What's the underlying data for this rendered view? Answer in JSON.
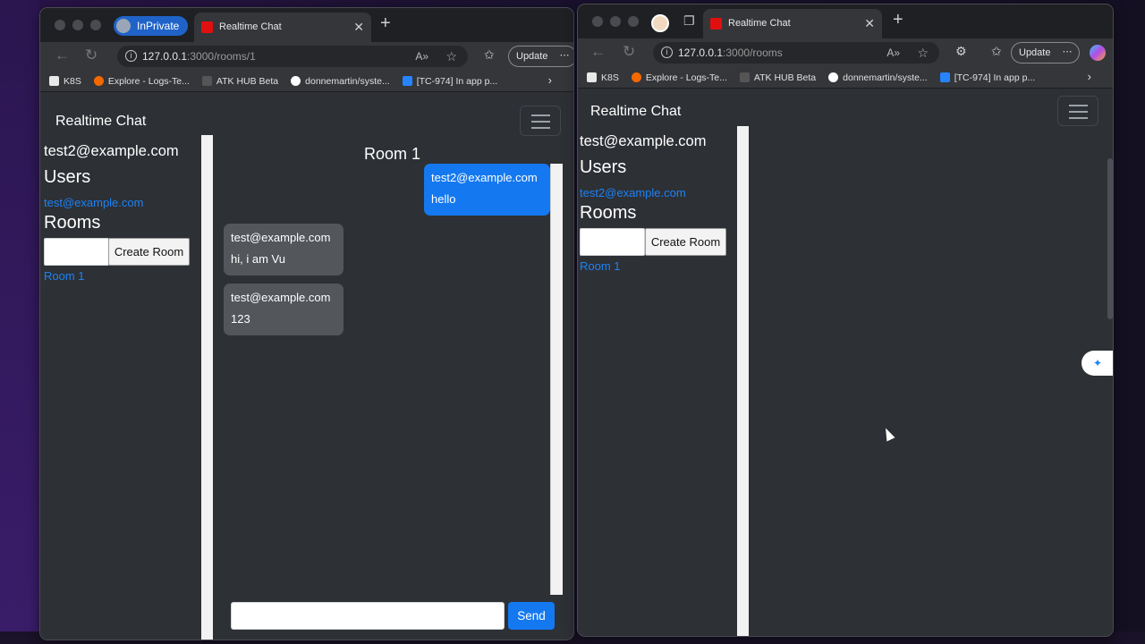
{
  "left_window": {
    "inprivate_label": "InPrivate",
    "tab_title": "Realtime Chat",
    "url_host": "127.0.0.1",
    "url_path": ":3000/rooms/1",
    "update_label": "Update",
    "bookmarks": [
      {
        "label": "K8S"
      },
      {
        "label": "Explore - Logs-Te..."
      },
      {
        "label": "ATK HUB Beta"
      },
      {
        "label": "donnemartin/syste..."
      },
      {
        "label": "[TC-974] In app p..."
      }
    ],
    "app": {
      "brand": "Realtime Chat",
      "current_user": "test2@example.com",
      "users_heading": "Users",
      "users": [
        "test@example.com"
      ],
      "rooms_heading": "Rooms",
      "create_room_label": "Create Room",
      "rooms": [
        "Room 1"
      ],
      "room_title": "Room 1",
      "messages": [
        {
          "sender": "test2@example.com",
          "text": "hello",
          "mine": true
        },
        {
          "sender": "test@example.com",
          "text": "hi, i am Vu",
          "mine": false
        },
        {
          "sender": "test@example.com",
          "text": "123",
          "mine": false
        }
      ],
      "send_label": "Send"
    }
  },
  "right_window": {
    "tab_title": "Realtime Chat",
    "url_host": "127.0.0.1",
    "url_path": ":3000/rooms",
    "update_label": "Update",
    "bookmarks": [
      {
        "label": "K8S"
      },
      {
        "label": "Explore - Logs-Te..."
      },
      {
        "label": "ATK HUB Beta"
      },
      {
        "label": "donnemartin/syste..."
      },
      {
        "label": "[TC-974] In app p..."
      }
    ],
    "app": {
      "brand": "Realtime Chat",
      "current_user": "test@example.com",
      "users_heading": "Users",
      "users": [
        "test2@example.com"
      ],
      "rooms_heading": "Rooms",
      "create_room_label": "Create Room",
      "rooms": [
        "Room 1"
      ]
    }
  },
  "colors": {
    "accent": "#1478f0",
    "link": "#1e82f5",
    "page_bg": "#2d3035",
    "other_message_bg": "#53565b",
    "favicon": "#e01010"
  }
}
